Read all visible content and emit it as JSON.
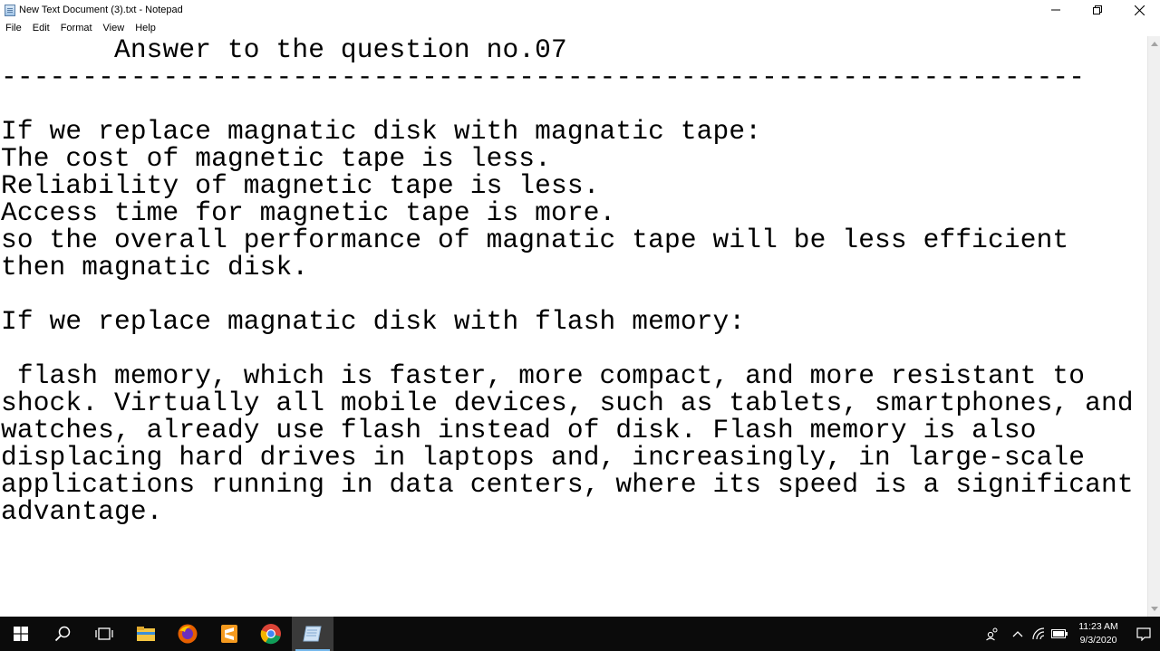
{
  "window": {
    "title": "New Text Document (3).txt - Notepad",
    "minimize_glyph": "—",
    "restore_glyph": "❐",
    "close_glyph": "✕"
  },
  "menu": {
    "items": [
      "File",
      "Edit",
      "Format",
      "View",
      "Help"
    ]
  },
  "editor": {
    "content": "       Answer to the question no.07\n-------------------------------------------------------------------\n\nIf we replace magnatic disk with magnatic tape:\nThe cost of magnetic tape is less.\nReliability of magnetic tape is less.\nAccess time for magnetic tape is more.\nso the overall performance of magnatic tape will be less efficient\nthen magnatic disk.\n\nIf we replace magnatic disk with flash memory:\n\n flash memory, which is faster, more compact, and more resistant to\nshock. Virtually all mobile devices, such as tablets, smartphones, and\nwatches, already use flash instead of disk. Flash memory is also\ndisplacing hard drives in laptops and, increasingly, in large-scale\napplications running in data centers, where its speed is a significant\nadvantage."
  },
  "taskbar": {
    "icons": [
      "windows-start-icon",
      "search-icon",
      "task-view-icon",
      "file-explorer-icon",
      "firefox-icon",
      "sublime-text-icon",
      "chrome-icon",
      "notepad-icon"
    ],
    "tray_icons": [
      "people-icon",
      "chevron-up-icon",
      "wifi-icon",
      "battery-icon",
      "notification-icon"
    ]
  },
  "clock": {
    "time": "11:23 AM",
    "date": "9/3/2020"
  },
  "colors": {
    "taskbar_bg": "#0b0b0b",
    "accent": "#76b9ed",
    "sublime": "#f59a1e",
    "explorer": "#f4c542"
  }
}
